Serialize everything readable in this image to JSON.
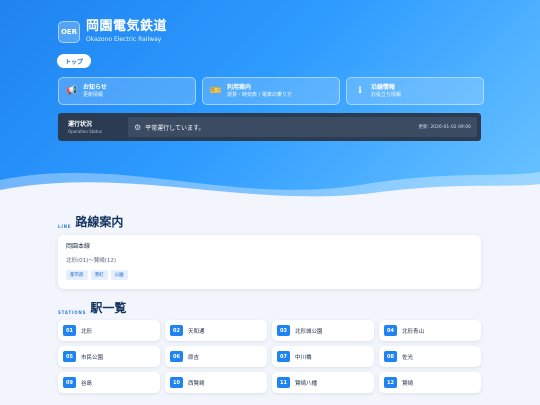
{
  "brand": {
    "logo": "OER",
    "name": "岡園電気鉄道",
    "sub": "Okazono Electric Railway"
  },
  "nav": {
    "top": "トップ"
  },
  "menu": [
    {
      "icon": "megaphone-icon",
      "glyph": "📢",
      "title": "お知らせ",
      "sub": "更新情報"
    },
    {
      "icon": "ticket-icon",
      "glyph": "🎫",
      "title": "利用案内",
      "sub": "運賃・時刻表 / 電車の乗り方"
    },
    {
      "icon": "info-icon",
      "glyph": "ℹ",
      "title": "沿線情報",
      "sub": "お役立ち情報"
    }
  ],
  "operation": {
    "title": "運行状況",
    "sub": "Operation Status",
    "icon": "gear-icon",
    "message": "平常運行しています。",
    "updated": "更新: 2026-01-02 09:06"
  },
  "line_section": {
    "en": "LINE",
    "ja": "路線案内"
  },
  "line": {
    "name": "岡園本線",
    "route": "北形(01)〜賢崎(12)",
    "tags": [
      "都市部",
      "港町",
      "公園"
    ]
  },
  "station_section": {
    "en": "STATIONS",
    "ja": "駅一覧"
  },
  "stations": [
    {
      "num": "01",
      "name": "北形"
    },
    {
      "num": "02",
      "name": "天和通"
    },
    {
      "num": "03",
      "name": "北形城公園"
    },
    {
      "num": "04",
      "name": "北形青山"
    },
    {
      "num": "05",
      "name": "市民公園"
    },
    {
      "num": "06",
      "name": "原吉"
    },
    {
      "num": "07",
      "name": "中川橋"
    },
    {
      "num": "08",
      "name": "佐光"
    },
    {
      "num": "09",
      "name": "谷島"
    },
    {
      "num": "10",
      "name": "西賢崎"
    },
    {
      "num": "11",
      "name": "賢崎八幡"
    },
    {
      "num": "12",
      "name": "賢崎"
    }
  ],
  "colors": {
    "accent": "#1f83f0",
    "status_bar": "#2b3b52"
  }
}
